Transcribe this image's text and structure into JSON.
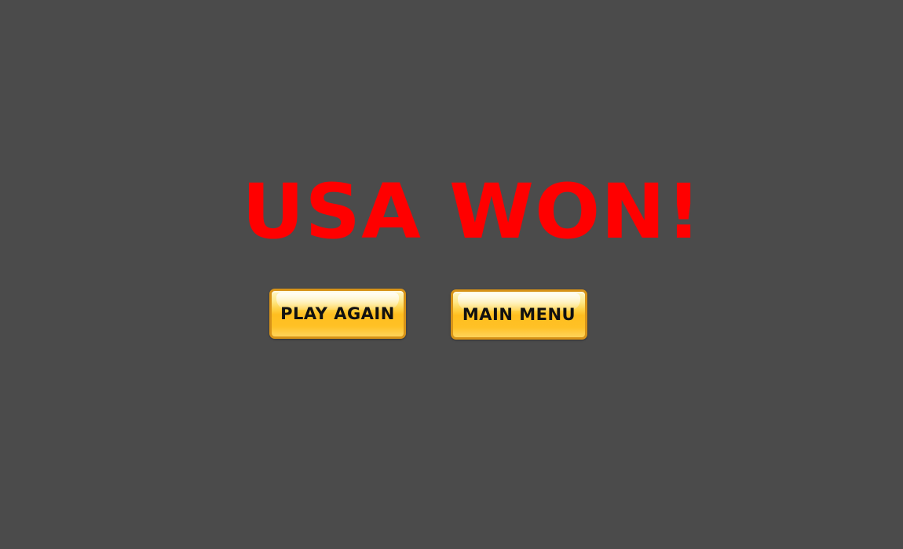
{
  "screen": {
    "title": "USA WON!"
  },
  "buttons": {
    "play_again_label": "PLAY AGAIN",
    "main_menu_label": "MAIN MENU"
  },
  "colors": {
    "background": "#4b4b4b",
    "title": "#ff0000",
    "button_fill": "#ffc126",
    "button_border": "#d79318",
    "button_text": "#111111"
  }
}
